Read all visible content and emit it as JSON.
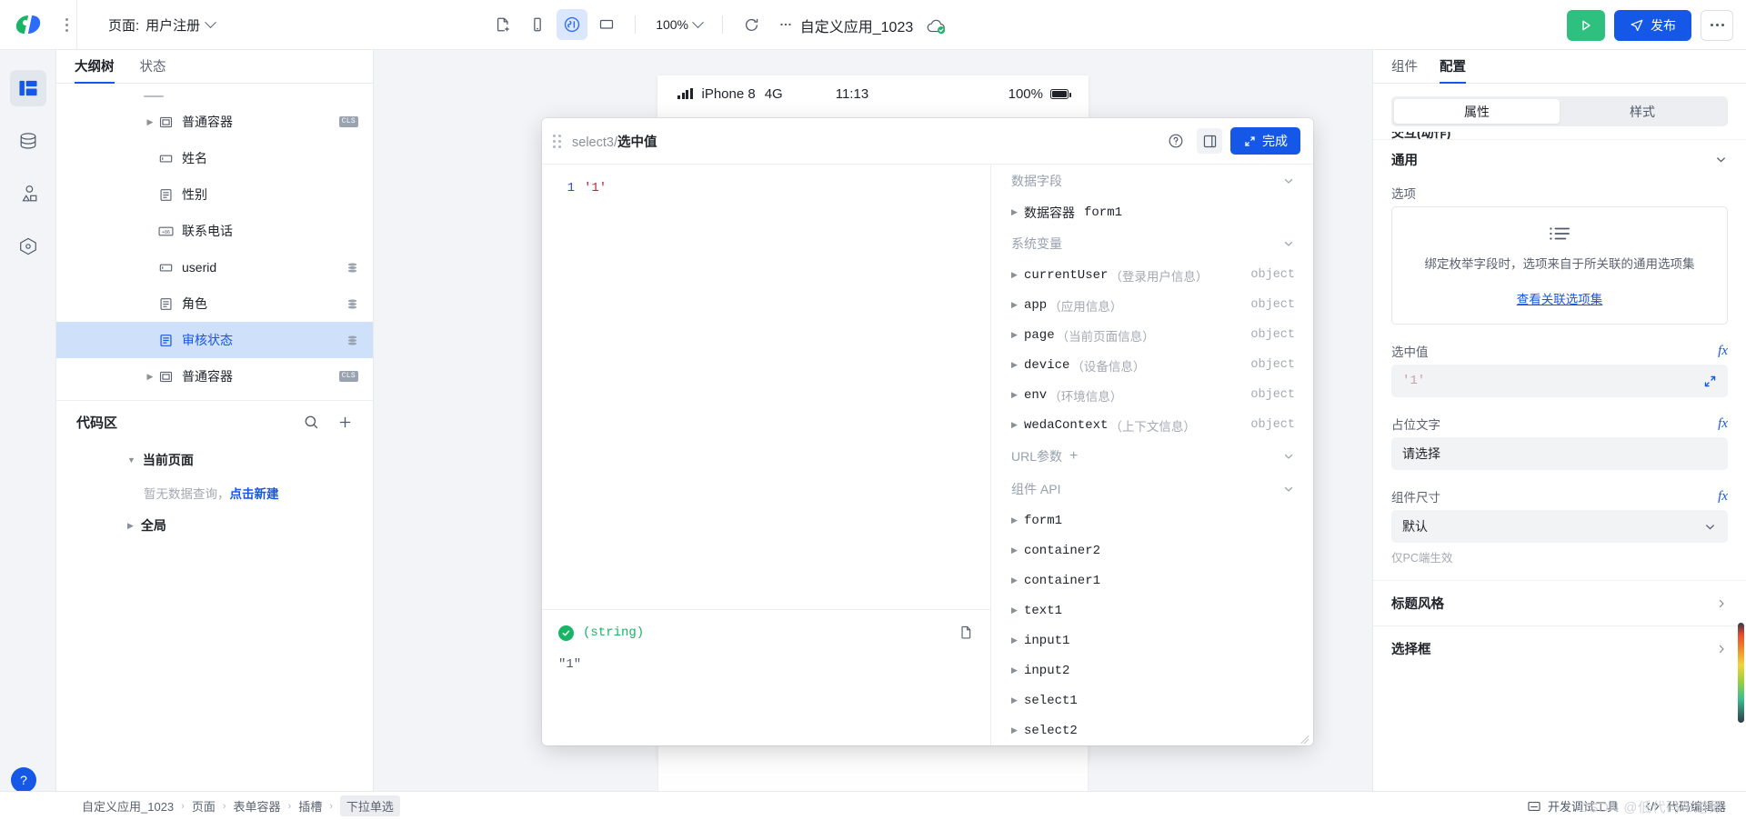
{
  "topbar": {
    "logo_name": "weda-logo",
    "page_label": "页面:",
    "page_name": "用户注册",
    "zoom": "100%",
    "app_title": "自定义应用_1023",
    "run_label": "运行",
    "publish_label": "发布",
    "tools": [
      {
        "name": "new-page-icon",
        "title": "新建页面"
      },
      {
        "name": "mobile-view-icon",
        "title": "移动端"
      },
      {
        "name": "component-view-icon",
        "title": "组件"
      },
      {
        "name": "desktop-view-icon",
        "title": "PC端"
      }
    ],
    "refresh_title": "刷新",
    "more_title": "更多"
  },
  "rail": {
    "items": [
      {
        "name": "layout-icon",
        "label": "大纲"
      },
      {
        "name": "database-icon",
        "label": "数据"
      },
      {
        "name": "shapes-icon",
        "label": "组件"
      },
      {
        "name": "plugin-icon",
        "label": "插件"
      }
    ],
    "help_label": "?"
  },
  "left_panel": {
    "tabs": [
      {
        "label": "大纲树",
        "active": true
      },
      {
        "label": "状态",
        "active": false
      }
    ],
    "tree": [
      {
        "label": "普通容器",
        "icon": "container-icon",
        "arrow": true,
        "indent": 1,
        "badge": "CLS",
        "selected": false
      },
      {
        "label": "姓名",
        "icon": "input-icon",
        "arrow": false,
        "indent": 2,
        "badge": "",
        "selected": false
      },
      {
        "label": "性别",
        "icon": "select-icon",
        "arrow": false,
        "indent": 2,
        "badge": "",
        "selected": false
      },
      {
        "label": "联系电话",
        "icon": "phone-icon",
        "arrow": false,
        "indent": 2,
        "badge": "",
        "selected": false
      },
      {
        "label": "userid",
        "icon": "input-icon",
        "arrow": false,
        "indent": 2,
        "badge": "DB",
        "selected": false
      },
      {
        "label": "角色",
        "icon": "select-icon",
        "arrow": false,
        "indent": 2,
        "badge": "DB",
        "selected": false
      },
      {
        "label": "审核状态",
        "icon": "select-icon",
        "arrow": false,
        "indent": 2,
        "badge": "DB",
        "selected": true
      },
      {
        "label": "普通容器",
        "icon": "container-icon",
        "arrow": true,
        "indent": 1,
        "badge": "CLS",
        "selected": false
      }
    ],
    "code_section": {
      "title": "代码区",
      "search_icon": "search-icon",
      "add_icon": "plus-icon",
      "current_page_label": "当前页面",
      "empty_text": "暂无数据查询，",
      "empty_link": "点击新建",
      "global_label": "全局"
    }
  },
  "canvas": {
    "device": {
      "model": "iPhone 8",
      "network": "4G",
      "time": "11:13",
      "battery": "100%"
    }
  },
  "modal": {
    "title_prefix": "select3",
    "title_sep": "/",
    "title_name": "选中值",
    "help_icon": "question-icon",
    "panel_icon": "panel-toggle-icon",
    "done_label": "完成",
    "editor": {
      "line_number": "1",
      "code": "'1'"
    },
    "result": {
      "status_icon": "check-circle-icon",
      "type_label": "(string)",
      "copy_icon": "copy-icon",
      "value": "\"1\""
    },
    "sections": [
      {
        "title": "数据字段",
        "has_plus": false,
        "items": [
          {
            "name": "数据容器",
            "extra": "form1",
            "type": "",
            "cn": true
          }
        ]
      },
      {
        "title": "系统变量",
        "has_plus": false,
        "items": [
          {
            "name": "currentUser",
            "extra": "（登录用户信息）",
            "type": "object",
            "cn": false
          },
          {
            "name": "app",
            "extra": "（应用信息）",
            "type": "object",
            "cn": false
          },
          {
            "name": "page",
            "extra": "（当前页面信息）",
            "type": "object",
            "cn": false
          },
          {
            "name": "device",
            "extra": "（设备信息）",
            "type": "object",
            "cn": false
          },
          {
            "name": "env",
            "extra": "（环境信息）",
            "type": "object",
            "cn": false
          },
          {
            "name": "wedaContext",
            "extra": "（上下文信息）",
            "type": "object",
            "cn": false
          }
        ]
      },
      {
        "title": "URL参数",
        "has_plus": true,
        "items": []
      },
      {
        "title": "组件 API",
        "has_plus": false,
        "items": [
          {
            "name": "form1",
            "extra": "",
            "type": "",
            "cn": false
          },
          {
            "name": "container2",
            "extra": "",
            "type": "",
            "cn": false
          },
          {
            "name": "container1",
            "extra": "",
            "type": "",
            "cn": false
          },
          {
            "name": "text1",
            "extra": "",
            "type": "",
            "cn": false
          },
          {
            "name": "input1",
            "extra": "",
            "type": "",
            "cn": false
          },
          {
            "name": "input2",
            "extra": "",
            "type": "",
            "cn": false
          },
          {
            "name": "select1",
            "extra": "",
            "type": "",
            "cn": false
          },
          {
            "name": "select2",
            "extra": "",
            "type": "",
            "cn": false
          }
        ]
      }
    ]
  },
  "right_panel": {
    "tabs": [
      {
        "label": "组件",
        "active": false
      },
      {
        "label": "配置",
        "active": true
      }
    ],
    "segments": [
      {
        "label": "属性",
        "active": true
      },
      {
        "label": "样式",
        "active": false
      }
    ],
    "clipped_label": "交互(动作)",
    "group_general": "通用",
    "option_field": {
      "label": "选项",
      "icon": "list-icon",
      "desc": "绑定枚举字段时，选项来自于所关联的通用选项集",
      "link": "查看关联选项集"
    },
    "selected_value": {
      "label": "选中值",
      "fx": "fx",
      "value": "'1'",
      "expand_icon": "expand-icon"
    },
    "placeholder_field": {
      "label": "占位文字",
      "fx": "fx",
      "value": "请选择"
    },
    "size_field": {
      "label": "组件尺寸",
      "fx": "fx",
      "value": "默认",
      "hint": "仅PC端生效"
    },
    "rows": [
      {
        "label": "标题风格"
      },
      {
        "label": "选择框"
      }
    ]
  },
  "bottom": {
    "breadcrumb": [
      "自定义应用_1023",
      "页面",
      "表单容器",
      "插槽",
      "下拉单选"
    ],
    "actions": [
      {
        "label": "开发调试工具",
        "icon": "debug-icon"
      },
      {
        "label": "代码编辑器",
        "icon": "code-icon"
      }
    ],
    "watermark": "CSDN @低代码布道师"
  }
}
